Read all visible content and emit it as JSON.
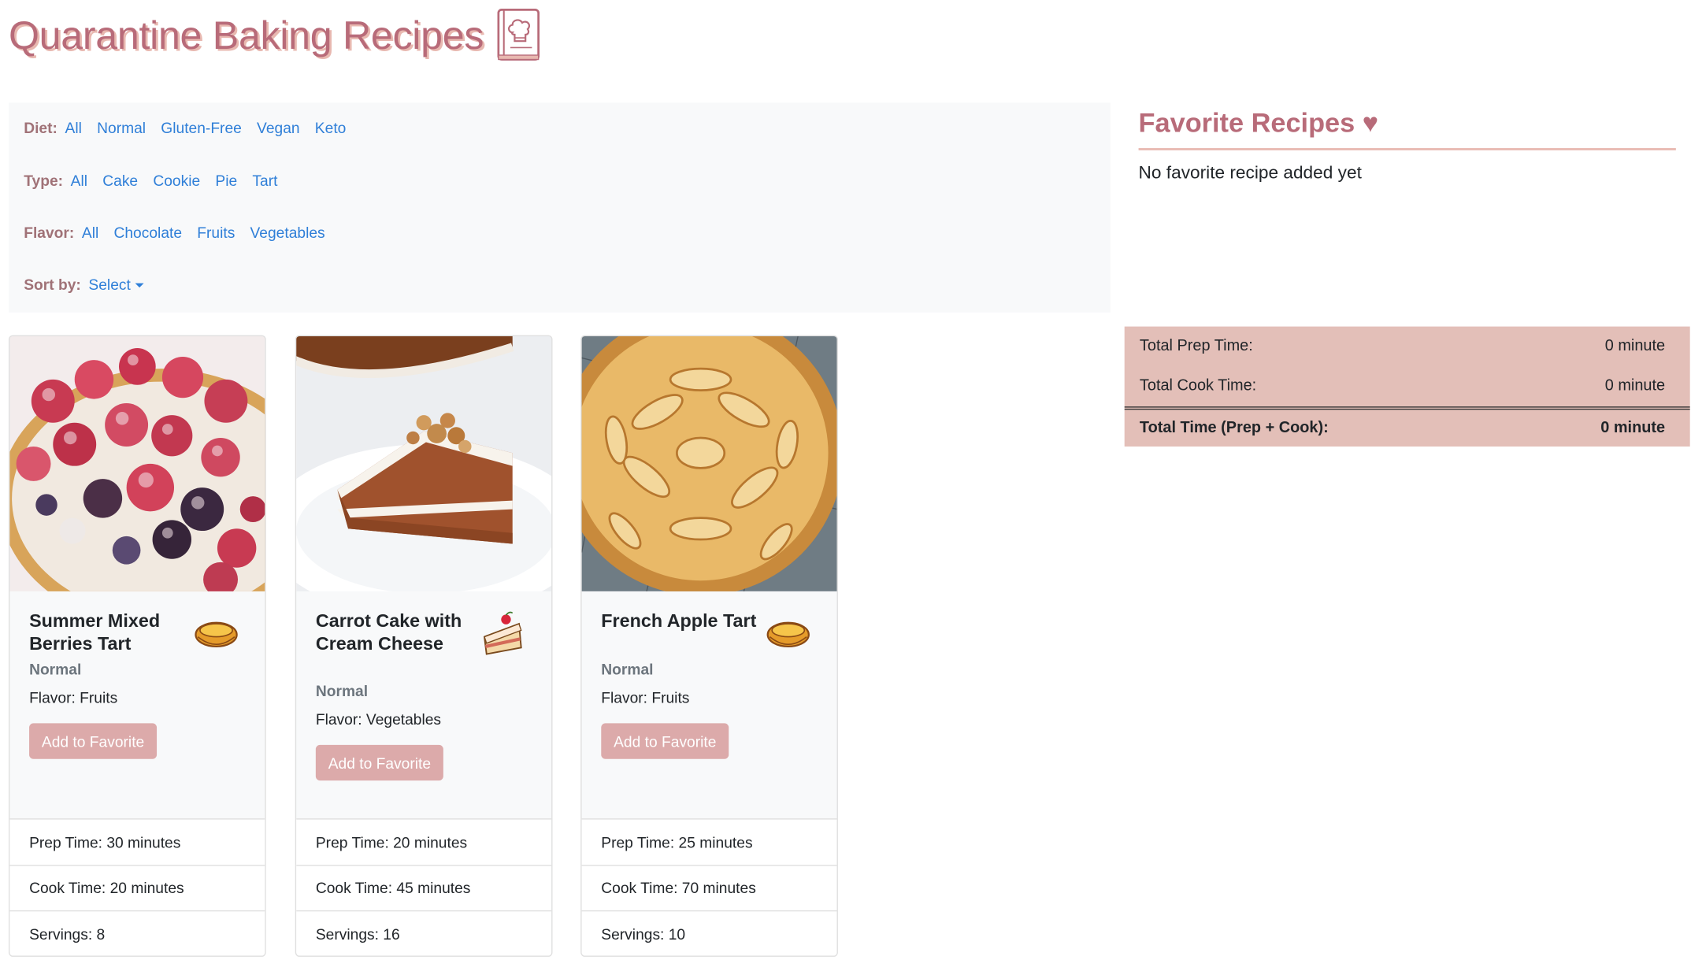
{
  "header": {
    "title": "Quarantine Baking Recipes"
  },
  "filters": {
    "diet": {
      "label": "Diet:",
      "options": [
        "All",
        "Normal",
        "Gluten-Free",
        "Vegan",
        "Keto"
      ]
    },
    "type": {
      "label": "Type:",
      "options": [
        "All",
        "Cake",
        "Cookie",
        "Pie",
        "Tart"
      ]
    },
    "flavor": {
      "label": "Flavor:",
      "options": [
        "All",
        "Chocolate",
        "Fruits",
        "Vegetables"
      ]
    },
    "sort": {
      "label": "Sort by:",
      "selected": "Select"
    }
  },
  "recipes": [
    {
      "title": "Summer Mixed Berries Tart",
      "icon": "tart-icon",
      "diet": "Normal",
      "flavor": "Flavor: Fruits",
      "button": "Add to Favorite",
      "prep": "Prep Time: 30 minutes",
      "cook": "Cook Time: 20 minutes",
      "servings": "Servings: 8"
    },
    {
      "title": "Carrot Cake with Cream Cheese",
      "icon": "cake-slice-icon",
      "diet": "Normal",
      "flavor": "Flavor: Vegetables",
      "button": "Add to Favorite",
      "prep": "Prep Time: 20 minutes",
      "cook": "Cook Time: 45 minutes",
      "servings": "Servings: 16"
    },
    {
      "title": "French Apple Tart",
      "icon": "tart-icon",
      "diet": "Normal",
      "flavor": "Flavor: Fruits",
      "button": "Add to Favorite",
      "prep": "Prep Time: 25 minutes",
      "cook": "Cook Time: 70 minutes",
      "servings": "Servings: 10"
    }
  ],
  "favorites": {
    "heading": "Favorite Recipes ♥",
    "empty_text": "No favorite recipe added yet",
    "totals": {
      "prep_label": "Total Prep Time:",
      "prep_value": "0 minute",
      "cook_label": "Total Cook Time:",
      "cook_value": "0 minute",
      "total_label": "Total Time (Prep + Cook):",
      "total_value": "0 minute"
    }
  },
  "colors": {
    "brand": "#b86b79",
    "link": "#2f7fd8",
    "button": "#dcaaaa",
    "totals_background": "#e3bfb8"
  }
}
